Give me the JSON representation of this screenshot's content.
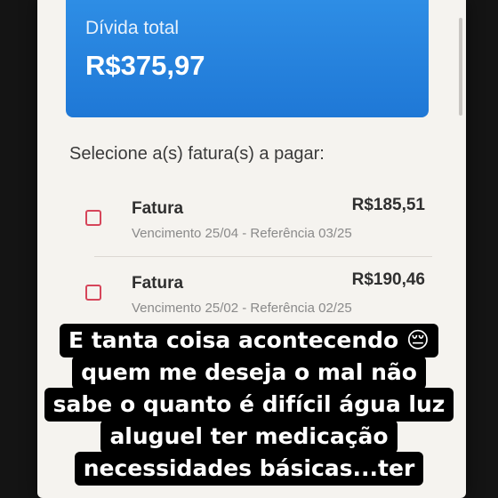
{
  "debt": {
    "label": "Dívida total",
    "amount": "R$375,97"
  },
  "invoices": {
    "heading": "Selecione a(s) fatura(s) a pagar:",
    "items": [
      {
        "title": "Fatura",
        "amount": "R$185,51",
        "details": "Vencimento 25/04 - Referência 03/25",
        "checked": false
      },
      {
        "title": "Fatura",
        "amount": "R$190,46",
        "details": "Vencimento 25/02 - Referência 02/25",
        "checked": false
      }
    ]
  },
  "caption": {
    "lines": [
      "E tanta coisa acontecendo 😔",
      "quem me deseja o mal não",
      "sabe o quanto é difícil água luz",
      "aluguel ter medicação",
      "necessidades básicas...ter"
    ]
  },
  "colors": {
    "card": "#1f78d6",
    "checkbox_border": "#d6455a",
    "caption_bg": "#000000"
  }
}
